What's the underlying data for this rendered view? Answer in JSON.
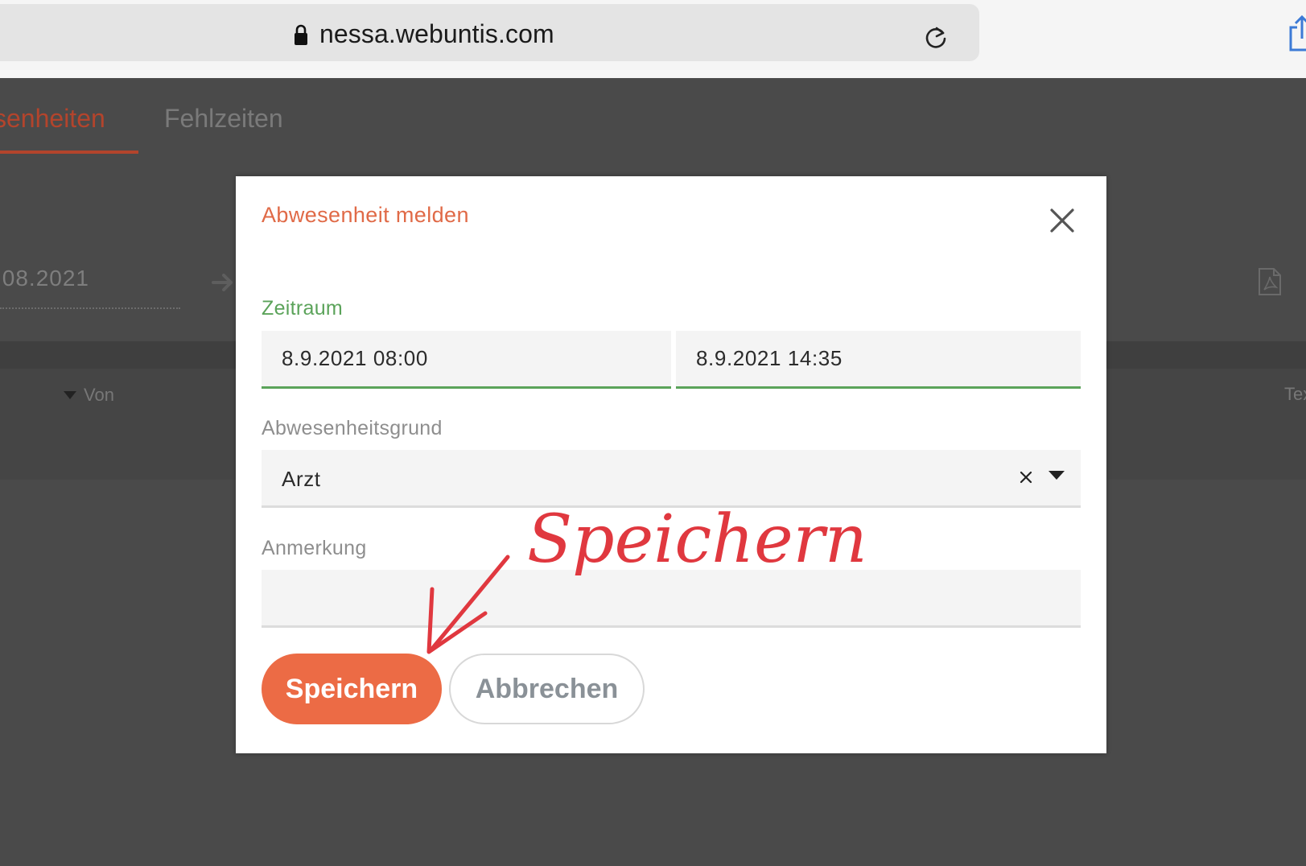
{
  "browser": {
    "url": "nessa.webuntis.com",
    "icons": [
      "lock-icon",
      "reload-icon",
      "share-icon"
    ]
  },
  "background": {
    "tabs": [
      {
        "label": "senheiten",
        "active": true
      },
      {
        "label": "Fehlzeiten",
        "active": false
      }
    ],
    "date_from": ".08.2021",
    "table_headers": [
      "Von",
      "Tex"
    ],
    "icons": [
      "arrow-right-icon",
      "pdf-icon",
      "caret-down-icon"
    ]
  },
  "dialog": {
    "title": "Abwesenheit melden",
    "period_label": "Zeitraum",
    "period_from": "8.9.2021 08:00",
    "period_to": "8.9.2021 14:35",
    "reason_label": "Abwesenheitsgrund",
    "reason_value": "Arzt",
    "note_label": "Anmerkung",
    "note_value": "",
    "save_label": "Speichern",
    "cancel_label": "Abbrechen",
    "icons": [
      "close-icon",
      "clear-icon",
      "chevron-down-icon"
    ]
  },
  "annotation": {
    "handwritten_text": "Speichern",
    "color": "#e0383f"
  },
  "colors": {
    "accent_orange": "#ec6b45",
    "title_orange": "#e06a47",
    "active_tab": "#b3442c",
    "valid_green": "#5ba35a",
    "overlay": "#4a4a4a"
  }
}
